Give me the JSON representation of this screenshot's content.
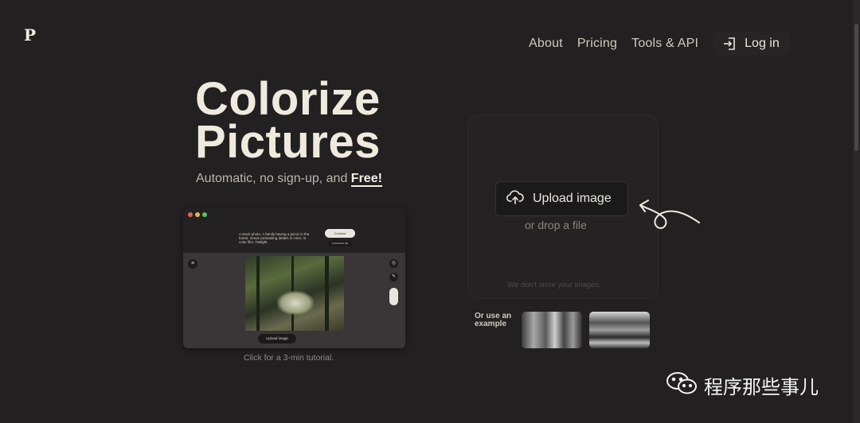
{
  "header": {
    "logo": "P",
    "nav": [
      "About",
      "Pricing",
      "Tools & API"
    ],
    "login_label": "Log in"
  },
  "hero": {
    "title_line1": "Colorize",
    "title_line2": "Pictures",
    "subtitle_prefix": "Automatic, no sign-up, and",
    "subtitle_free": "Free!"
  },
  "demo": {
    "prompt": "A stock photo. A family having a picnic in the forest. Great contrasting details in color. In color film. Twilight.",
    "colorize_label": "Colorize",
    "surprise_label": "SURPRISE ME",
    "upload_label": "Upload image",
    "tutorial": "Click for a 3-min tutorial."
  },
  "uploader": {
    "button_label": "Upload image",
    "drop_text": "or drop a file",
    "privacy_note": "We don't store your images."
  },
  "examples": {
    "label": "Or use an example"
  },
  "watermark": {
    "text": "程序那些事儿"
  },
  "colors": {
    "background": "#222021",
    "title": "#efeadd",
    "muted": "#8a8680"
  }
}
